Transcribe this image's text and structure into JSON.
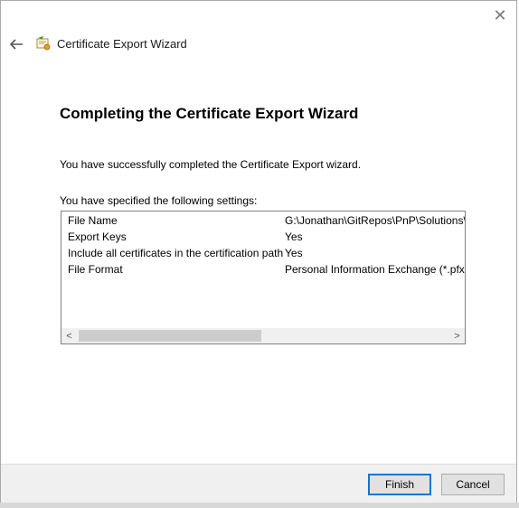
{
  "window": {
    "title": "Certificate Export Wizard",
    "close_glyph": "✕",
    "back_glyph": "←"
  },
  "page": {
    "heading": "Completing the Certificate Export Wizard",
    "message": "You have successfully completed the Certificate Export wizard.",
    "settings_label": "You have specified the following settings:"
  },
  "settings": [
    {
      "name": "File Name",
      "value": "G:\\Jonathan\\GitRepos\\PnP\\Solutions\\E"
    },
    {
      "name": "Export Keys",
      "value": "Yes"
    },
    {
      "name": "Include all certificates in the certification path",
      "value": "Yes"
    },
    {
      "name": "File Format",
      "value": "Personal Information Exchange (*.pfx)"
    }
  ],
  "scrollbar": {
    "left_arrow": "<",
    "right_arrow": ">"
  },
  "buttons": {
    "finish": "Finish",
    "cancel": "Cancel"
  },
  "icons": {
    "back": "back-arrow-icon",
    "certificate": "certificate-icon",
    "close": "close-icon"
  },
  "colors": {
    "default_button_border": "#0078d7",
    "footer_bg": "#f0f0f0"
  }
}
